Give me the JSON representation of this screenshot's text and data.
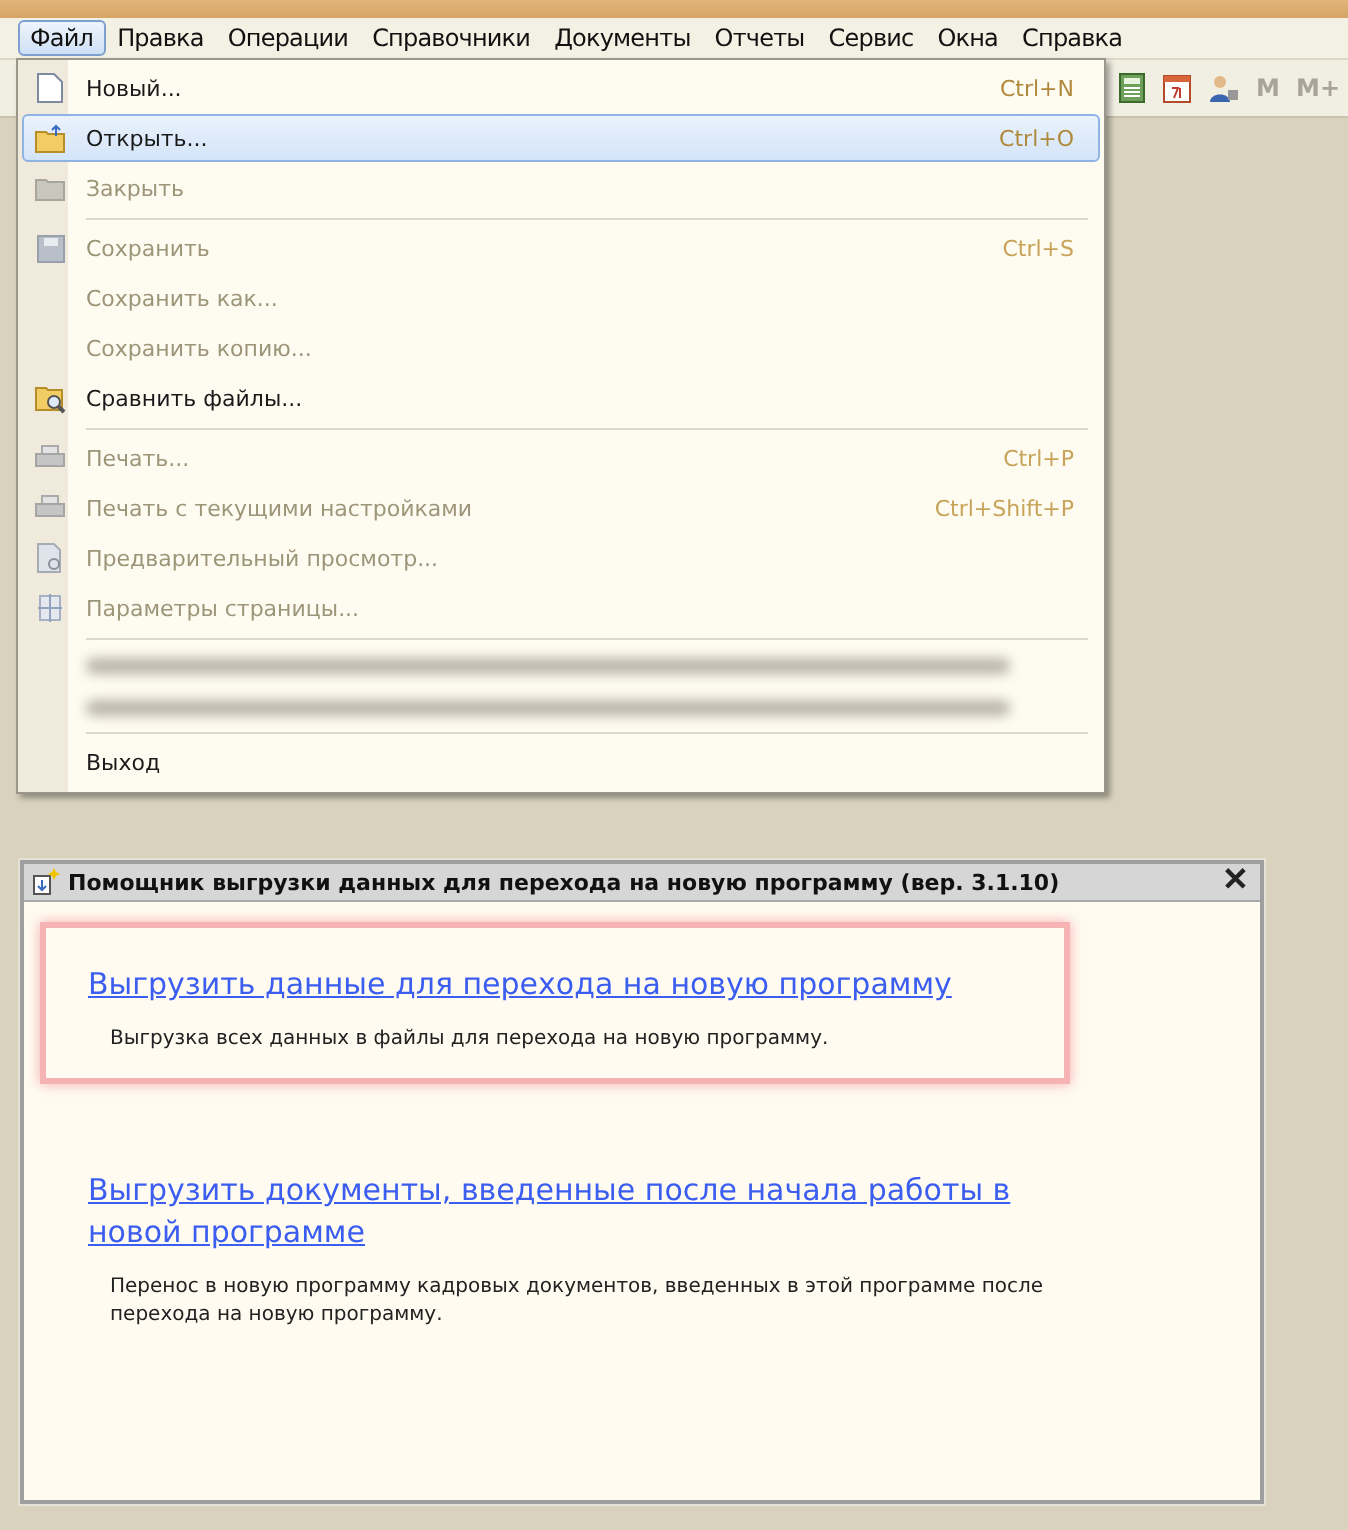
{
  "menu_bar": [
    {
      "label": "Файл",
      "selected": true
    },
    {
      "label": "Правка",
      "selected": false
    },
    {
      "label": "Операции",
      "selected": false
    },
    {
      "label": "Справочники",
      "selected": false
    },
    {
      "label": "Документы",
      "selected": false
    },
    {
      "label": "Отчеты",
      "selected": false
    },
    {
      "label": "Сервис",
      "selected": false
    },
    {
      "label": "Окна",
      "selected": false
    },
    {
      "label": "Справка",
      "selected": false
    }
  ],
  "toolbar": [
    {
      "kind": "icon"
    },
    {
      "kind": "icon"
    },
    {
      "kind": "icon"
    },
    {
      "kind": "text",
      "label": "M"
    },
    {
      "kind": "text",
      "label": "M+"
    }
  ],
  "file_menu": [
    {
      "kind": "item",
      "label": "Новый...",
      "shortcut": "Ctrl+N",
      "disabled": false,
      "selected": false
    },
    {
      "kind": "item",
      "label": "Открыть...",
      "shortcut": "Ctrl+O",
      "disabled": false,
      "selected": true
    },
    {
      "kind": "item",
      "label": "Закрыть",
      "disabled": true,
      "selected": false
    },
    {
      "kind": "separator"
    },
    {
      "kind": "item",
      "label": "Сохранить",
      "shortcut": "Ctrl+S",
      "disabled": true,
      "selected": false
    },
    {
      "kind": "item",
      "label": "Сохранить как...",
      "disabled": true,
      "selected": false
    },
    {
      "kind": "item",
      "label": "Сохранить копию...",
      "disabled": true,
      "selected": false
    },
    {
      "kind": "item",
      "label": "Сравнить файлы...",
      "disabled": false,
      "selected": false
    },
    {
      "kind": "separator"
    },
    {
      "kind": "item",
      "label": "Печать...",
      "shortcut": "Ctrl+P",
      "disabled": true,
      "selected": false
    },
    {
      "kind": "item",
      "label": "Печать с текущими настройками",
      "shortcut": "Ctrl+Shift+P",
      "disabled": true,
      "selected": false
    },
    {
      "kind": "item",
      "label": "Предварительный просмотр...",
      "disabled": true,
      "selected": false
    },
    {
      "kind": "item",
      "label": "Параметры страницы...",
      "disabled": true,
      "selected": false
    },
    {
      "kind": "separator"
    },
    {
      "kind": "blurred"
    },
    {
      "kind": "blurred"
    },
    {
      "kind": "separator"
    },
    {
      "kind": "item",
      "label": "Выход",
      "disabled": false,
      "selected": false
    }
  ],
  "dialog": {
    "close": "✕",
    "title": "Помощник выгрузки данных для перехода на новую программу (вер. 3.1.10)",
    "sections": [
      {
        "link": "Выгрузить данные для перехода на новую программу",
        "description": "Выгрузка всех данных в файлы для перехода на новую программу.",
        "highlighted": true
      },
      {
        "link": "Выгрузить документы, введенные после начала работы в новой программе",
        "description": "Перенос в новую программу кадровых документов, введенных в этой программе после перехода на новую программу.",
        "highlighted": false
      }
    ]
  }
}
